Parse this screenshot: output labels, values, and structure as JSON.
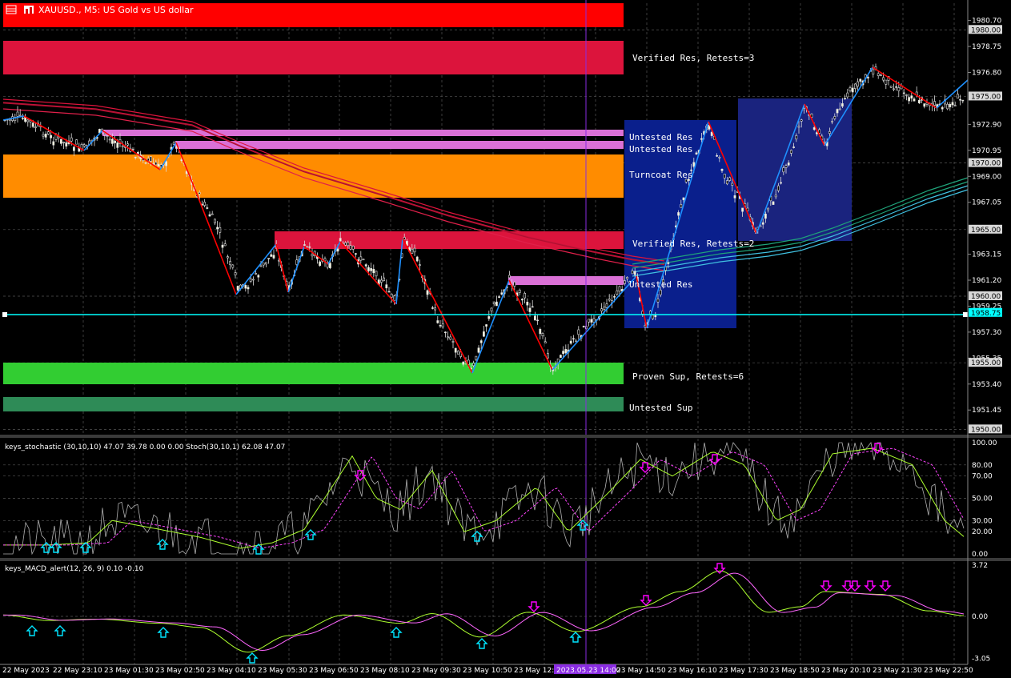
{
  "header": {
    "title": "XAUUSD., M5: US Gold vs US dollar"
  },
  "zones": [
    {
      "label": "Verified Res, Retests=3",
      "color": "#dc143c"
    },
    {
      "label": "Untested Res",
      "color": "#da70d6"
    },
    {
      "label": "Untested Res",
      "color": "#da70d6"
    },
    {
      "label": "Turncoat Res",
      "color": "#ff8c00"
    },
    {
      "label": "Verified Res, Retests=2",
      "color": "#dc143c"
    },
    {
      "label": "Untested Res",
      "color": "#da70d6"
    },
    {
      "label": "Proven Sup, Retests=6",
      "color": "#32cd32"
    },
    {
      "label": "Untested Sup",
      "color": "#2e8b57"
    }
  ],
  "price_axis": {
    "ticks": [
      "1980.70",
      "1978.75",
      "1976.80",
      "1972.90",
      "1970.95",
      "1969.00",
      "1967.05",
      "1963.15",
      "1961.20",
      "1959.25",
      "1957.30",
      "1955.35",
      "1953.40",
      "1951.45"
    ],
    "marked": [
      "1980.00",
      "1975.00",
      "1970.00",
      "1965.00",
      "1960.00",
      "1958.75",
      "1955.00",
      "1950.00"
    ],
    "current": "1958.75"
  },
  "stoch": {
    "label": "keys_stochastic (30,10,10) 47.07 39.78 0.00 0.00 Stoch(30,10,1) 62.08 47.07",
    "ticks": [
      "100.00",
      "80.00",
      "70.00",
      "50.00",
      "30.00",
      "20.00",
      "0.00"
    ]
  },
  "macd": {
    "label": "keys_MACD_alert(12, 26, 9) 0.10 -0.10",
    "ticks": [
      "3.72",
      "0.00",
      "-3.05"
    ]
  },
  "time_axis": {
    "labels": [
      "22 May 2023",
      "22 May 23:10",
      "23 May 01:30",
      "23 May 02:50",
      "23 May 04:10",
      "23 May 05:30",
      "23 May 06:50",
      "23 May 08:10",
      "23 May 09:30",
      "23 May 10:50",
      "23 May 12:",
      "23 May 14:50",
      "23 May 16:10",
      "23 May 17:30",
      "23 May 18:50",
      "23 May 20:10",
      "23 May 21:30",
      "23 May 22:50"
    ],
    "cursor": "2023.05.23 14:00"
  },
  "colors": {
    "up_wave": "#1e90ff",
    "down_wave": "#ff0000",
    "hline": "#00ffff",
    "cursor": "#8a2be2"
  }
}
